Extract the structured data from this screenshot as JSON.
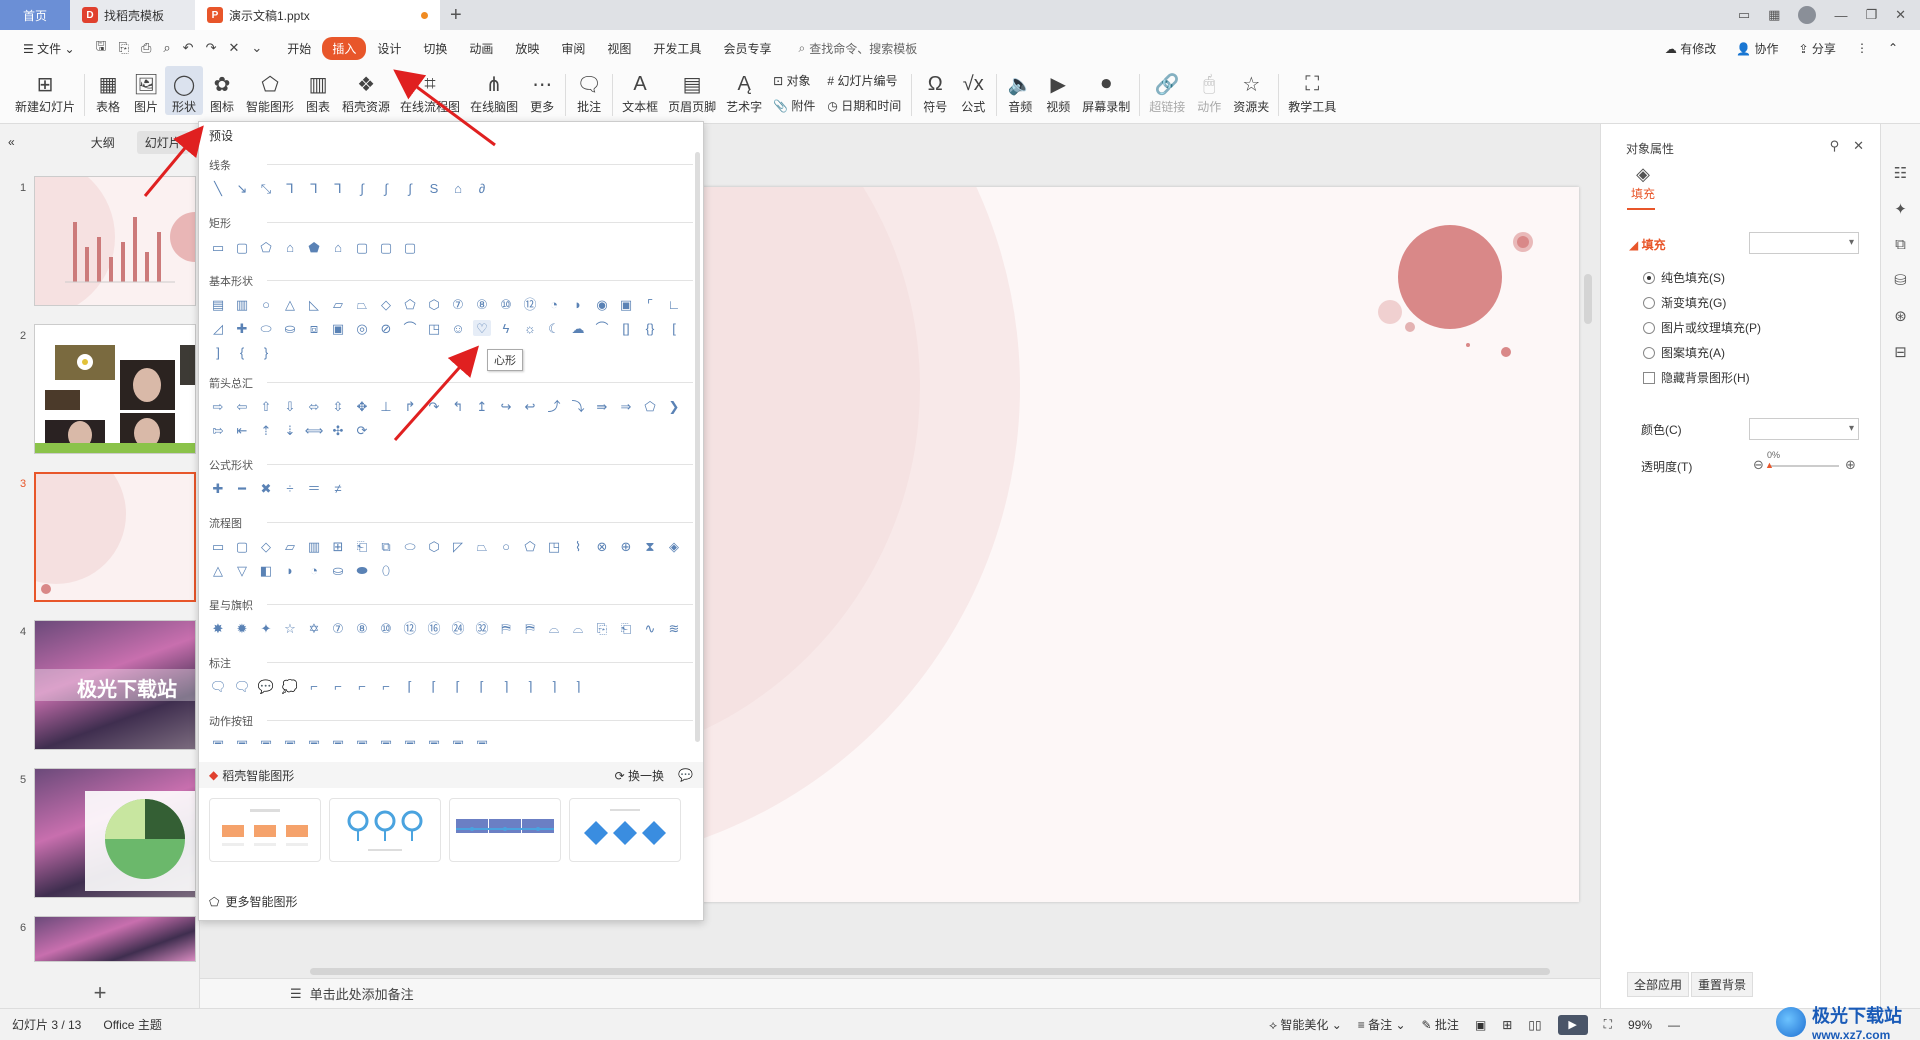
{
  "tabs": {
    "home": "首页",
    "template": "找稻壳模板",
    "doc": "演示文稿1.pptx"
  },
  "menu": {
    "file": "文件",
    "items": [
      "开始",
      "插入",
      "设计",
      "切换",
      "动画",
      "放映",
      "审阅",
      "视图",
      "开发工具",
      "会员专享"
    ],
    "active_index": 1,
    "search": "查找命令、搜索模板",
    "right": [
      "有修改",
      "协作",
      "分享"
    ]
  },
  "ribbon": {
    "new_slide": "新建幻灯片",
    "table": "表格",
    "picture": "图片",
    "shape": "形状",
    "icon": "图标",
    "smart": "智能图形",
    "chart": "图表",
    "docer": "稻壳资源",
    "flow": "在线流程图",
    "mind": "在线脑图",
    "more": "更多",
    "comment": "批注",
    "textbox": "文本框",
    "header": "页眉页脚",
    "art": "艺术字",
    "object": "对象",
    "attach": "附件",
    "slide_num": "幻灯片编号",
    "datetime": "日期和时间",
    "symbol": "符号",
    "formula": "公式",
    "audio": "音频",
    "video": "视频",
    "screenrec": "屏幕录制",
    "hyperlink": "超链接",
    "action": "动作",
    "resource": "资源夹",
    "teach": "教学工具"
  },
  "leftpanel": {
    "outline": "大纲",
    "slides": "幻灯片",
    "slide_numbers": [
      "1",
      "2",
      "3",
      "4",
      "5",
      "6"
    ],
    "thumb4_text": "极光下载站"
  },
  "shapes": {
    "preset": "预设",
    "categories": [
      "线条",
      "矩形",
      "基本形状",
      "箭头总汇",
      "公式形状",
      "流程图",
      "星与旗帜",
      "标注",
      "动作按钮"
    ],
    "tooltip": "心形",
    "smart_title": "稻壳智能图形",
    "swap": "换一换",
    "more_smart": "更多智能图形"
  },
  "notes": "单击此处添加备注",
  "rightpane": {
    "title": "对象属性",
    "fill_tab": "填充",
    "fill_section": "填充",
    "options": [
      "纯色填充(S)",
      "渐变填充(G)",
      "图片或纹理填充(P)",
      "图案填充(A)"
    ],
    "selected_option": 0,
    "hide_bg": "隐藏背景图形(H)",
    "color": "颜色(C)",
    "transparency": "透明度(T)",
    "transparency_value": "0%",
    "apply_all": "全部应用",
    "reset_bg": "重置背景"
  },
  "status": {
    "slide_info": "幻灯片 3 / 13",
    "theme": "Office 主题",
    "beautify": "智能美化",
    "notes": "备注",
    "comment": "批注",
    "zoom": "99%"
  },
  "watermark": {
    "line1": "极光下载站",
    "line2": "www.xz7.com"
  },
  "colors": {
    "accent": "#e8562a",
    "annotation_red": "#e02020",
    "slide_circle": "#d98888"
  }
}
